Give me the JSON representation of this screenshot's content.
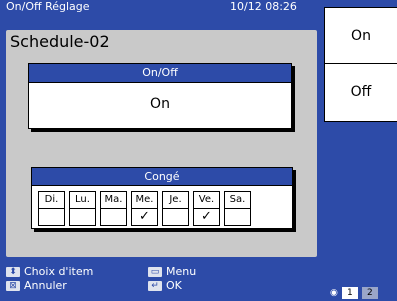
{
  "header": {
    "title": "On/Off Réglage",
    "datetime": "10/12 08:26"
  },
  "panel": {
    "schedule_name": "Schedule-02",
    "onoff": {
      "label": "On/Off",
      "value": "On"
    },
    "conge": {
      "label": "Congé",
      "days": [
        {
          "label": "Di.",
          "checked": ""
        },
        {
          "label": "Lu.",
          "checked": ""
        },
        {
          "label": "Ma.",
          "checked": ""
        },
        {
          "label": "Me.",
          "checked": "✓"
        },
        {
          "label": "Je.",
          "checked": ""
        },
        {
          "label": "Ve.",
          "checked": "✓"
        },
        {
          "label": "Sa.",
          "checked": ""
        }
      ]
    }
  },
  "side": {
    "on_label": "On",
    "off_label": "Off"
  },
  "footer": {
    "select_item": "Choix d'item",
    "cancel": "Annuler",
    "menu": "Menu",
    "ok": "OK"
  },
  "pager": {
    "pages": [
      "1",
      "2"
    ],
    "current": "1"
  },
  "colors": {
    "accent": "#2d4ba8",
    "panel": "#c9c9c9"
  }
}
